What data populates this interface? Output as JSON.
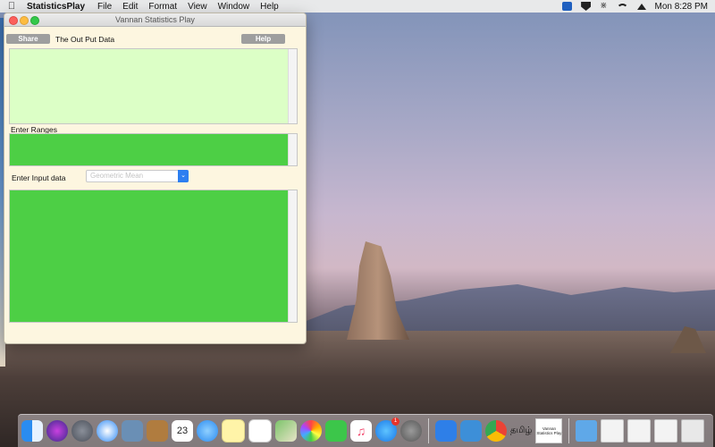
{
  "menubar": {
    "app_name": "StatisticsPlay",
    "items": [
      "File",
      "Edit",
      "Format",
      "View",
      "Window",
      "Help"
    ],
    "clock": "Mon 8:28 PM"
  },
  "window": {
    "title": "Vannan Statistics Play",
    "share_label": "Share",
    "help_label": "Help",
    "output_label": "The Out Put Data",
    "output_value": "",
    "ranges_label": "Enter Ranges",
    "ranges_value": "",
    "input_label": "Enter Input data",
    "input_value": "",
    "method_select": {
      "value": "Geometric Mean"
    }
  },
  "dock": {
    "calendar_date": "23",
    "appstore_badge": "1",
    "tamil_label": "தமிழ்",
    "doc_label": "Vannan Statistics Play"
  },
  "colors": {
    "output_bg": "#dcffc6",
    "input_bg": "#4dcf45",
    "window_bg": "#fdf6e0",
    "select_arrow": "#2d7ff0"
  }
}
